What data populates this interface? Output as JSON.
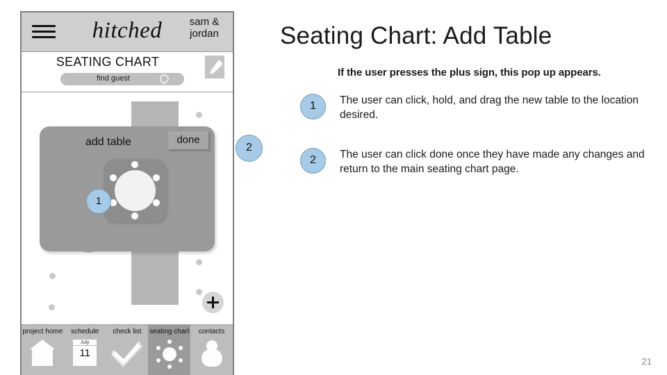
{
  "slide": {
    "title": "Seating Chart: Add Table",
    "intro": "If the user presses the plus sign, this pop up appears.",
    "page_number": "21",
    "callouts": [
      {
        "number": "1",
        "text": "The user can click, hold, and drag the new table to the location desired."
      },
      {
        "number": "2",
        "text": "The user can click done once they have made any changes and return to the main seating chart page."
      }
    ],
    "floating_badge": "2"
  },
  "phone": {
    "header": {
      "menu_icon": "hamburger-icon",
      "brand": "hitched",
      "user": "sam &\njordan",
      "user_line1": "sam &",
      "user_line2": "jordan"
    },
    "chart_header": {
      "title": "SEATING CHART",
      "search_value": "find guest",
      "search_placeholder": "find guest",
      "search_icon": "magnifier-icon",
      "edit_icon": "pencil-icon"
    },
    "canvas": {
      "popup": {
        "title": "add table",
        "done_label": "done",
        "badge": "1",
        "new_table_icon": "round-table-icon"
      },
      "add_button_icon": "plus-icon"
    },
    "bottom_nav": [
      {
        "label": "project home",
        "icon": "home-icon",
        "active": false
      },
      {
        "label": "schedule",
        "icon": "calendar-icon",
        "active": false,
        "month": "July",
        "day": "11"
      },
      {
        "label": "check list",
        "icon": "checkmark-icon",
        "active": false
      },
      {
        "label": "seating chart",
        "icon": "seating-chart-icon",
        "active": true
      },
      {
        "label": "contacts",
        "icon": "person-icon",
        "active": false
      }
    ]
  },
  "colors": {
    "badge_fill": "#a6cbe8",
    "badge_border": "#7b9bb5",
    "header_bar": "#cfcfcf",
    "nav_bar": "#bdbdbd",
    "nav_active": "#9a9a9a",
    "popup": "#9a9a9a"
  }
}
